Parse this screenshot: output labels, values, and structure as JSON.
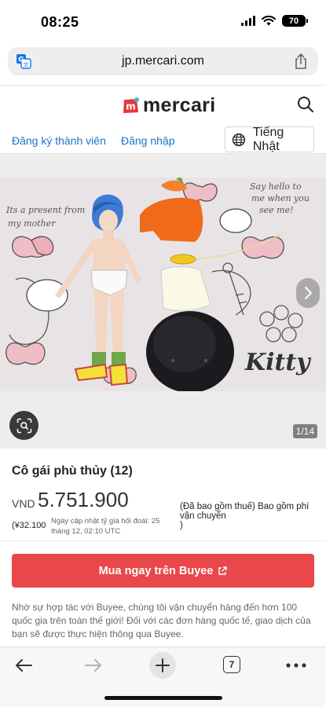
{
  "status": {
    "time": "08:25",
    "battery": "70"
  },
  "browser": {
    "url": "jp.mercari.com",
    "tab_count": "7"
  },
  "header": {
    "logo_text": "mercari"
  },
  "nav": {
    "register": "Đăng ký thành viên",
    "login": "Đăng nhập",
    "language": "Tiếng Nhật"
  },
  "gallery": {
    "counter": "1/14"
  },
  "product": {
    "title": "Cô gái phù thủy (12)",
    "currency": "VND",
    "price": "5.751.900",
    "tax_note": "(Đã bao gồm thuế) Bao gồm phí vận chuyển",
    "tax_note_close": ")",
    "yen_price": "(¥32.100",
    "rate_note": "Ngày cập nhật tỷ giá hối đoái: 25 tháng 12, 02:10 UTC"
  },
  "buy_button": {
    "label": "Mua ngay trên Buyee"
  },
  "info_text": "Nhờ sự hợp tác với Buyee, chúng tôi vận chuyển hàng đến hơn 100 quốc gia trên toàn thế giới! Đối với các đơn hàng quốc tế, giao dịch của bạn sẽ được thực hiện thông qua Buyee.",
  "colors": {
    "accent": "#e9474a",
    "link": "#1a73c8",
    "logo_red": "#e5383b"
  }
}
